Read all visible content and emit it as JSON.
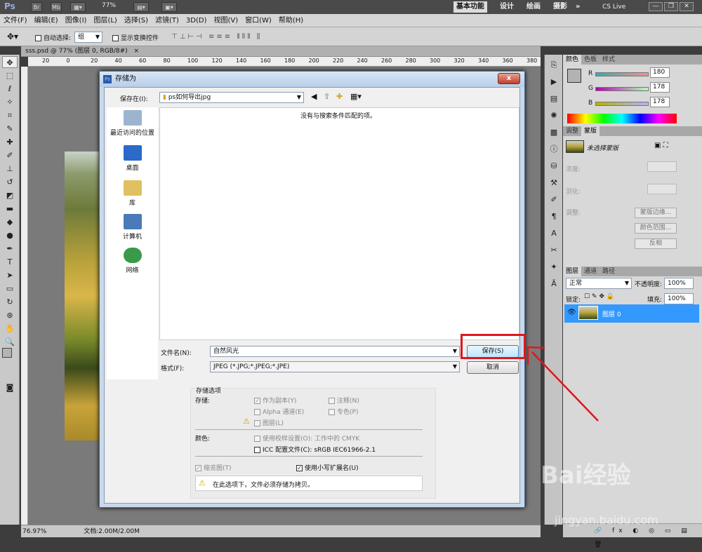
{
  "app": {
    "logo": "Ps",
    "mini_buttons": [
      "Br",
      "Mb"
    ],
    "zoom": "77%",
    "workspaces": [
      "基本功能",
      "设计",
      "绘画",
      "摄影"
    ],
    "more": "»",
    "cs_live": "CS Live"
  },
  "menu": [
    "文件(F)",
    "编辑(E)",
    "图像(I)",
    "图层(L)",
    "选择(S)",
    "滤镜(T)",
    "3D(D)",
    "视图(V)",
    "窗口(W)",
    "帮助(H)"
  ],
  "options": {
    "auto_select_label": "自动选择:",
    "auto_select_value": "组",
    "transform_label": "显示变换控件"
  },
  "document": {
    "tab_title": "sss.psd @ 77% (图层 0, RGB/8#)",
    "tab_close": "×",
    "ruler_marks": [
      "20",
      "0",
      "20",
      "40",
      "60",
      "80",
      "100",
      "120",
      "140",
      "160",
      "180",
      "200",
      "220",
      "240",
      "260",
      "280",
      "300",
      "320",
      "340",
      "360",
      "380"
    ]
  },
  "status": {
    "zoom": "76.97%",
    "doc": "文档:2.00M/2.00M"
  },
  "color_panel": {
    "tabs": [
      "颜色",
      "色板",
      "样式"
    ],
    "channels": [
      {
        "name": "R",
        "value": "180"
      },
      {
        "name": "G",
        "value": "178"
      },
      {
        "name": "B",
        "value": "178"
      }
    ]
  },
  "adjust_panel": {
    "tabs": [
      "调整",
      "蒙版"
    ],
    "mask_label": "未选择蒙版",
    "density": "浓度:",
    "feather": "羽化:",
    "refine": "调整:",
    "buttons": [
      "蒙版边缘...",
      "颜色范围...",
      "反相"
    ]
  },
  "layers_panel": {
    "tabs": [
      "图层",
      "通道",
      "路径"
    ],
    "blend_mode": "正常",
    "opacity_label": "不透明度:",
    "opacity": "100%",
    "lock_label": "锁定:",
    "fill_label": "填充:",
    "fill": "100%",
    "layer_name": "图层 0"
  },
  "dialog": {
    "title": "存储为",
    "close": "x",
    "save_in_label": "保存在(I):",
    "save_in_value": "ps如何导出jpg",
    "empty_message": "没有与搜索条件匹配的项。",
    "places": [
      "最近访问的位置",
      "桌面",
      "库",
      "计算机",
      "网络"
    ],
    "filename_label": "文件名(N):",
    "filename_value": "自然风光",
    "format_label": "格式(F):",
    "format_value": "JPEG (*.JPG;*.JPEG;*.JPE)",
    "save_button": "保存(S)",
    "cancel_button": "取消",
    "save_options_title": "存储选项",
    "store_label": "存储:",
    "opt_copy": "作为副本(Y)",
    "opt_notes": "注释(N)",
    "opt_alpha": "Alpha 通道(E)",
    "opt_spot": "专色(P)",
    "opt_layers": "图层(L)",
    "color_label": "颜色:",
    "opt_proof": "使用校样设置(O):",
    "proof_value": "工作中的 CMYK",
    "opt_icc": "ICC 配置文件(C):",
    "icc_value": "sRGB IEC61966-2.1",
    "opt_thumbnail": "缩览图(T)",
    "opt_lowercase": "使用小写扩展名(U)",
    "warning": "在此选项下，文件必须存储为拷贝。"
  },
  "watermark": {
    "brand": "Bai经验",
    "url": "jingyan.baidu.com"
  },
  "colors": {
    "highlight": "#e0161d",
    "selected_layer": "#3399ff"
  }
}
